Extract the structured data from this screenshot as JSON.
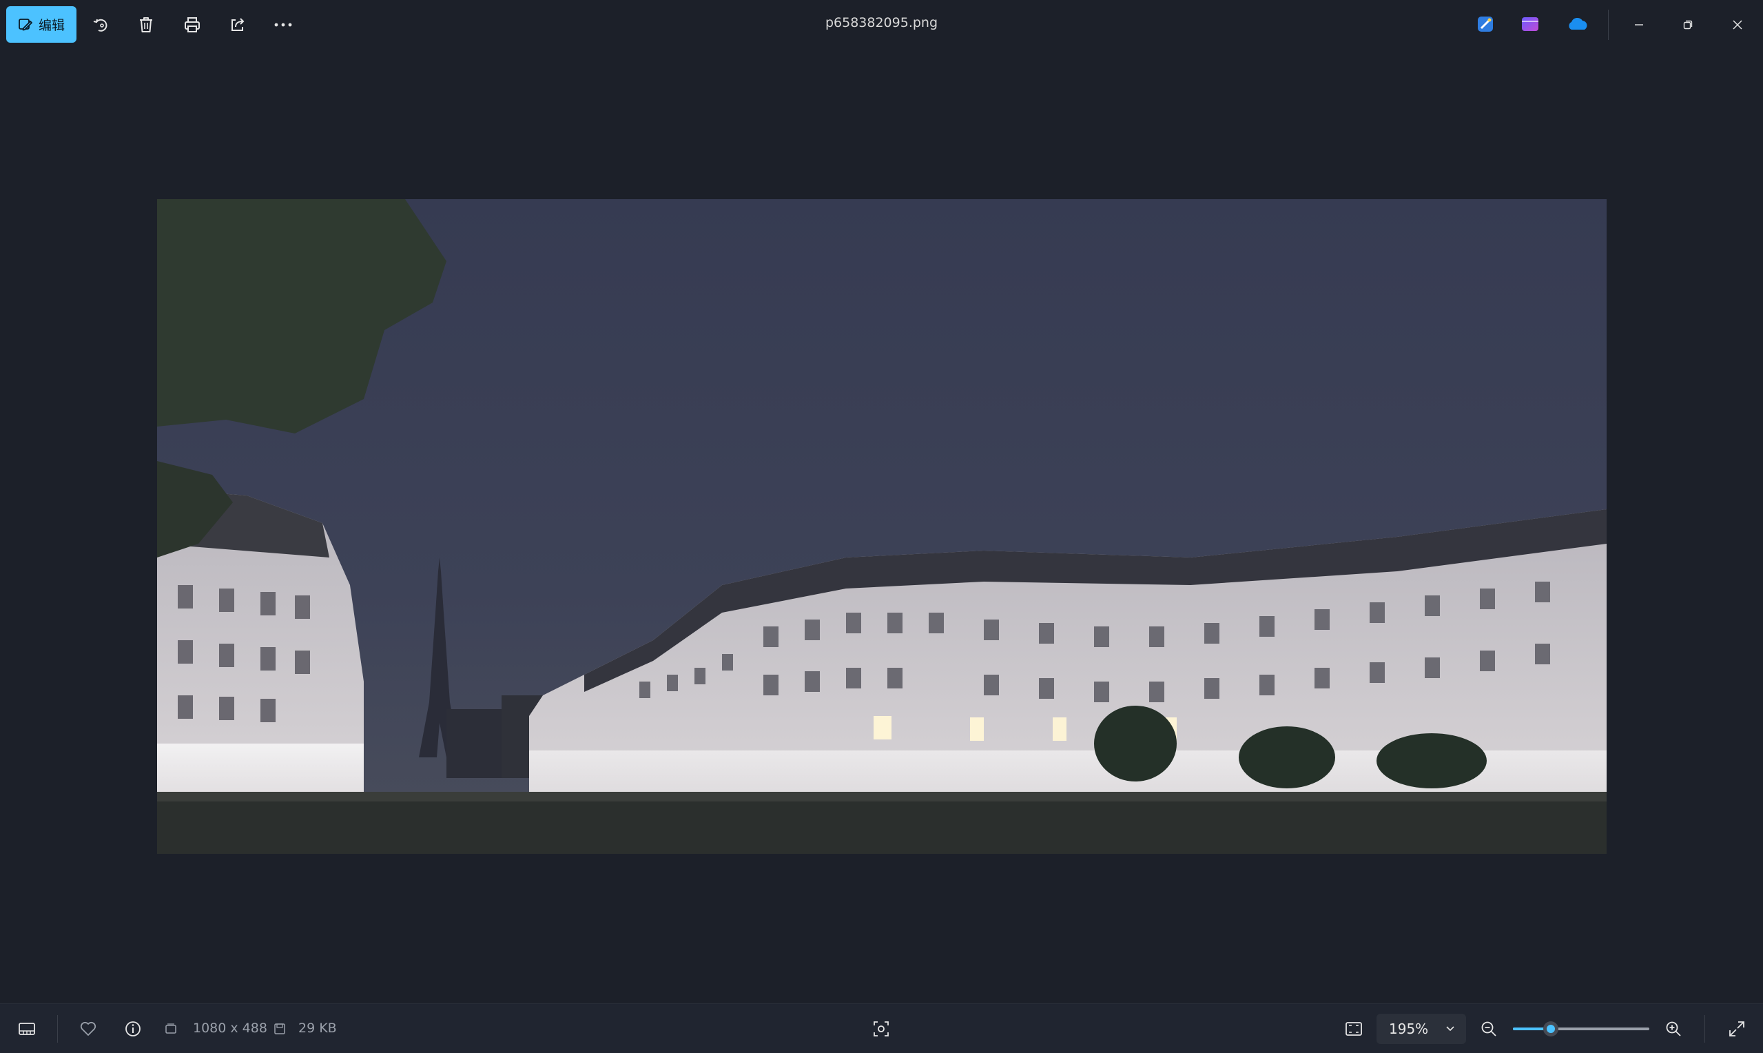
{
  "toolbar": {
    "edit_label": "编辑",
    "file_name": "p658382095.png"
  },
  "colors": {
    "accent": "#4cc2ff",
    "background": "#1c2029",
    "bottom_bar": "#202530"
  },
  "icons": {
    "edit": "edit-image-icon",
    "rotate": "rotate-icon",
    "delete": "trash-icon",
    "print": "print-icon",
    "share": "share-icon",
    "more": "more-icon",
    "designer": "designer-app-icon",
    "clipchamp": "clipchamp-app-icon",
    "onedrive": "onedrive-icon"
  },
  "status": {
    "dimensions": "1080 x 488",
    "file_size": "29 KB"
  },
  "zoom": {
    "value": "195%",
    "slider_fraction": 0.28
  }
}
